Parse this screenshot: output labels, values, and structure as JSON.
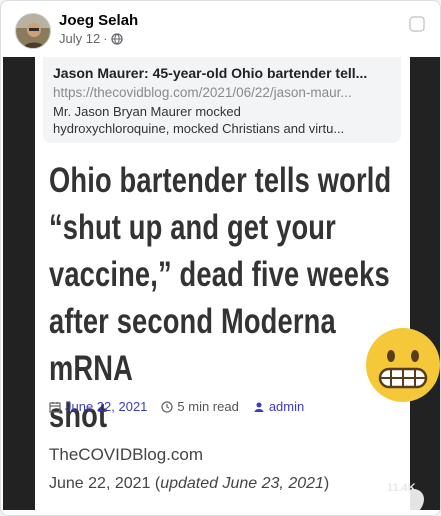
{
  "post": {
    "author": "Joeg Selah",
    "date": "July 12",
    "separator": "·",
    "icons": {
      "audience": "globe-icon",
      "menu": "more-options-icon",
      "avatar": "profile-photo"
    }
  },
  "link_card": {
    "title": "Jason Maurer: 45-year-old Ohio bartender tell...",
    "url": "https://thecovidblog.com/2021/06/22/jason-maur...",
    "description_line1": "Mr. Jason Bryan Maurer mocked",
    "description_line2": "hydroxychloroquine, mocked Christians and virtu..."
  },
  "article": {
    "headline_lines": [
      "Ohio bartender tells world",
      "“shut up and get your",
      "vaccine,” dead five weeks",
      "after second Moderna mRNA",
      "shot"
    ],
    "date": "June 22, 2021",
    "read_time": "5 min read",
    "author": "admin",
    "site": "TheCOVIDBlog.com",
    "pub_date": "June 22, 2021 (",
    "updated": "updated June 23, 2021",
    "pub_date_close": ")"
  },
  "overlay": {
    "emoji": "grimacing-face-emoji",
    "like_count": "11.4K",
    "like_icon": "heart-icon"
  },
  "colors": {
    "link_blue": "#3b3bc4",
    "headline": "#333333",
    "emoji_yellow": "#f5c83a"
  }
}
